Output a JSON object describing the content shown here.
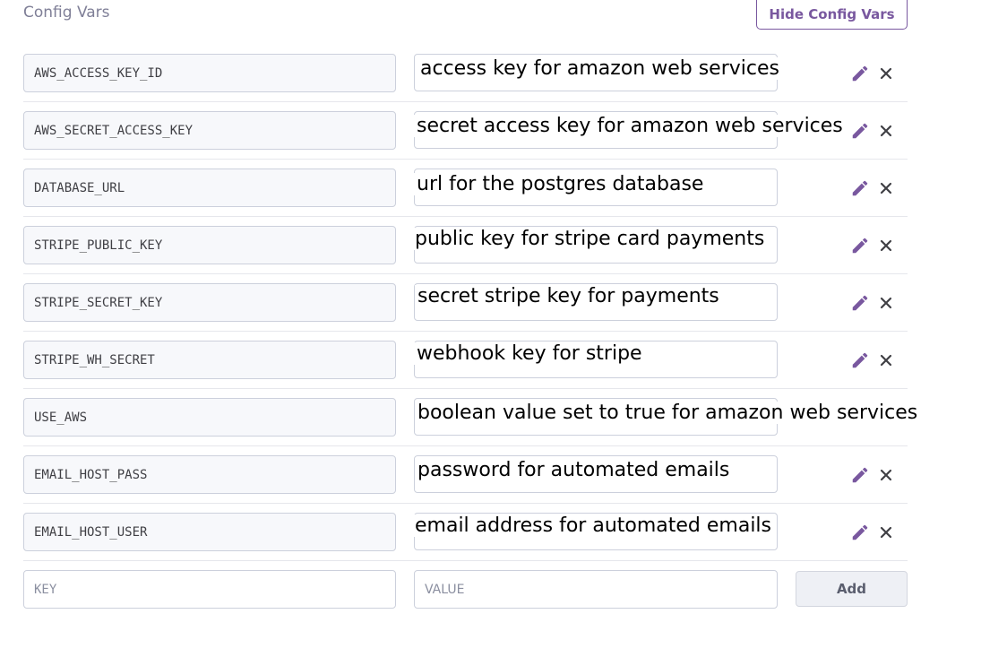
{
  "header": {
    "title": "Config Vars",
    "hide_button": "Hide Config Vars"
  },
  "config_vars": [
    {
      "key": "AWS_ACCESS_KEY_ID",
      "value": "access key for amazon web services"
    },
    {
      "key": "AWS_SECRET_ACCESS_KEY",
      "value": "secret access key for amazon web services"
    },
    {
      "key": "DATABASE_URL",
      "value": "url for the postgres database"
    },
    {
      "key": "STRIPE_PUBLIC_KEY",
      "value": "public key for stripe card payments"
    },
    {
      "key": "STRIPE_SECRET_KEY",
      "value": "secret stripe key for payments"
    },
    {
      "key": "STRIPE_WH_SECRET",
      "value": "webhook key for stripe"
    },
    {
      "key": "USE_AWS",
      "value": "boolean value set to true for amazon web services"
    },
    {
      "key": "EMAIL_HOST_PASS",
      "value": "password for automated emails"
    },
    {
      "key": "EMAIL_HOST_USER",
      "value": "email address for automated emails"
    }
  ],
  "new_var": {
    "key_placeholder": "KEY",
    "value_placeholder": "VALUE",
    "add_label": "Add"
  },
  "icons": {
    "edit": "pencil-icon",
    "delete": "close-icon"
  },
  "colors": {
    "accent": "#79589f",
    "delete": "#3f3f44"
  }
}
